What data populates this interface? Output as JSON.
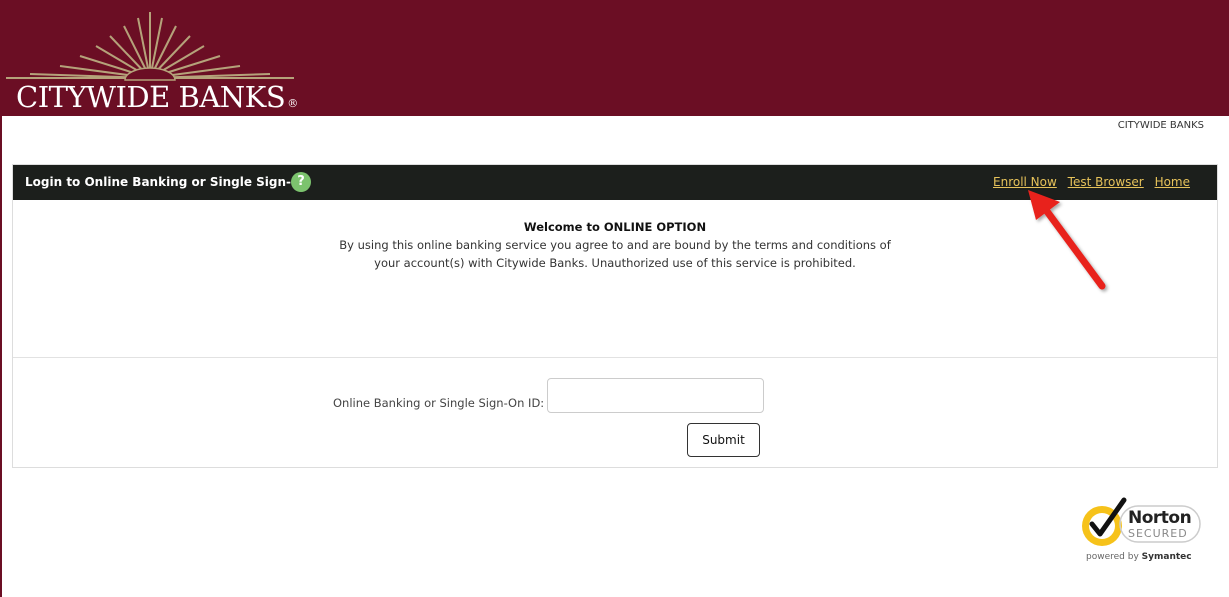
{
  "header": {
    "logo_text": "CITYWIDE BANKS",
    "logo_reg": "®"
  },
  "top_right_label": "CITYWIDE BANKS",
  "panel": {
    "title": "Login to Online Banking or Single Sign-On",
    "help_icon": "question-mark",
    "links": {
      "enroll": "Enroll Now",
      "test_browser": "Test Browser",
      "home": "Home"
    },
    "welcome_title": "Welcome to ONLINE OPTION",
    "welcome_body": "By using this online banking service you agree to and are bound by the terms and conditions of your account(s) with Citywide Banks. Unauthorized use of this service is prohibited."
  },
  "login": {
    "label": "Online Banking or Single Sign-On ID:",
    "value": "",
    "submit_label": "Submit"
  },
  "badge": {
    "name": "Norton",
    "status": "SECURED",
    "powered_by_prefix": "powered by",
    "powered_by_brand": "Symantec"
  },
  "colors": {
    "brand": "#6b0e24",
    "header_bar": "#1c1f1c",
    "link": "#e6c25a",
    "help": "#7cc36e",
    "annotation_arrow": "#e8201c"
  }
}
